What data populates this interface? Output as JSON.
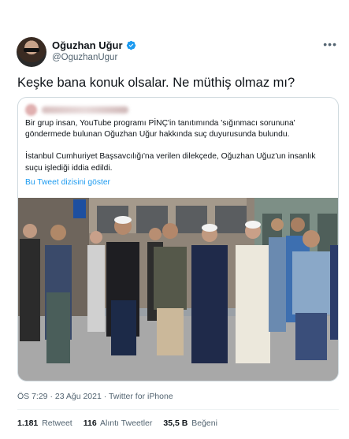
{
  "author": {
    "name": "Oğuzhan Uğur",
    "handle": "@OguzhanUgur",
    "verified": true
  },
  "tweet_text": "Keşke bana konuk olsalar. Ne müthiş olmaz mı?",
  "quoted_tweet": {
    "paragraph_1": "Bir grup insan, YouTube programı PİNÇ'in tanıtımında 'sığınmacı sorununa' göndermede bulunan Oğuzhan Uğur hakkında suç duyurusunda bulundu.",
    "paragraph_2": "İstanbul Cumhuriyet Başsavcılığı'na verilen dilekçede, Oğuzhan Uğuz'un insanlık suçu işlediği iddia edildi.",
    "thread_link": "Bu Tweet dizisini göster"
  },
  "timestamp": "ÖS 7:29 · 23 Ağu 2021 · Twitter for iPhone",
  "stats": [
    {
      "value": "1.181",
      "label": "Retweet"
    },
    {
      "value": "116",
      "label": "Alıntı Tweetler"
    },
    {
      "value": "35,5 B",
      "label": "Beğeni"
    }
  ],
  "colors": {
    "accent": "#1d9bf0",
    "text": "#0f1419",
    "muted": "#536471"
  }
}
